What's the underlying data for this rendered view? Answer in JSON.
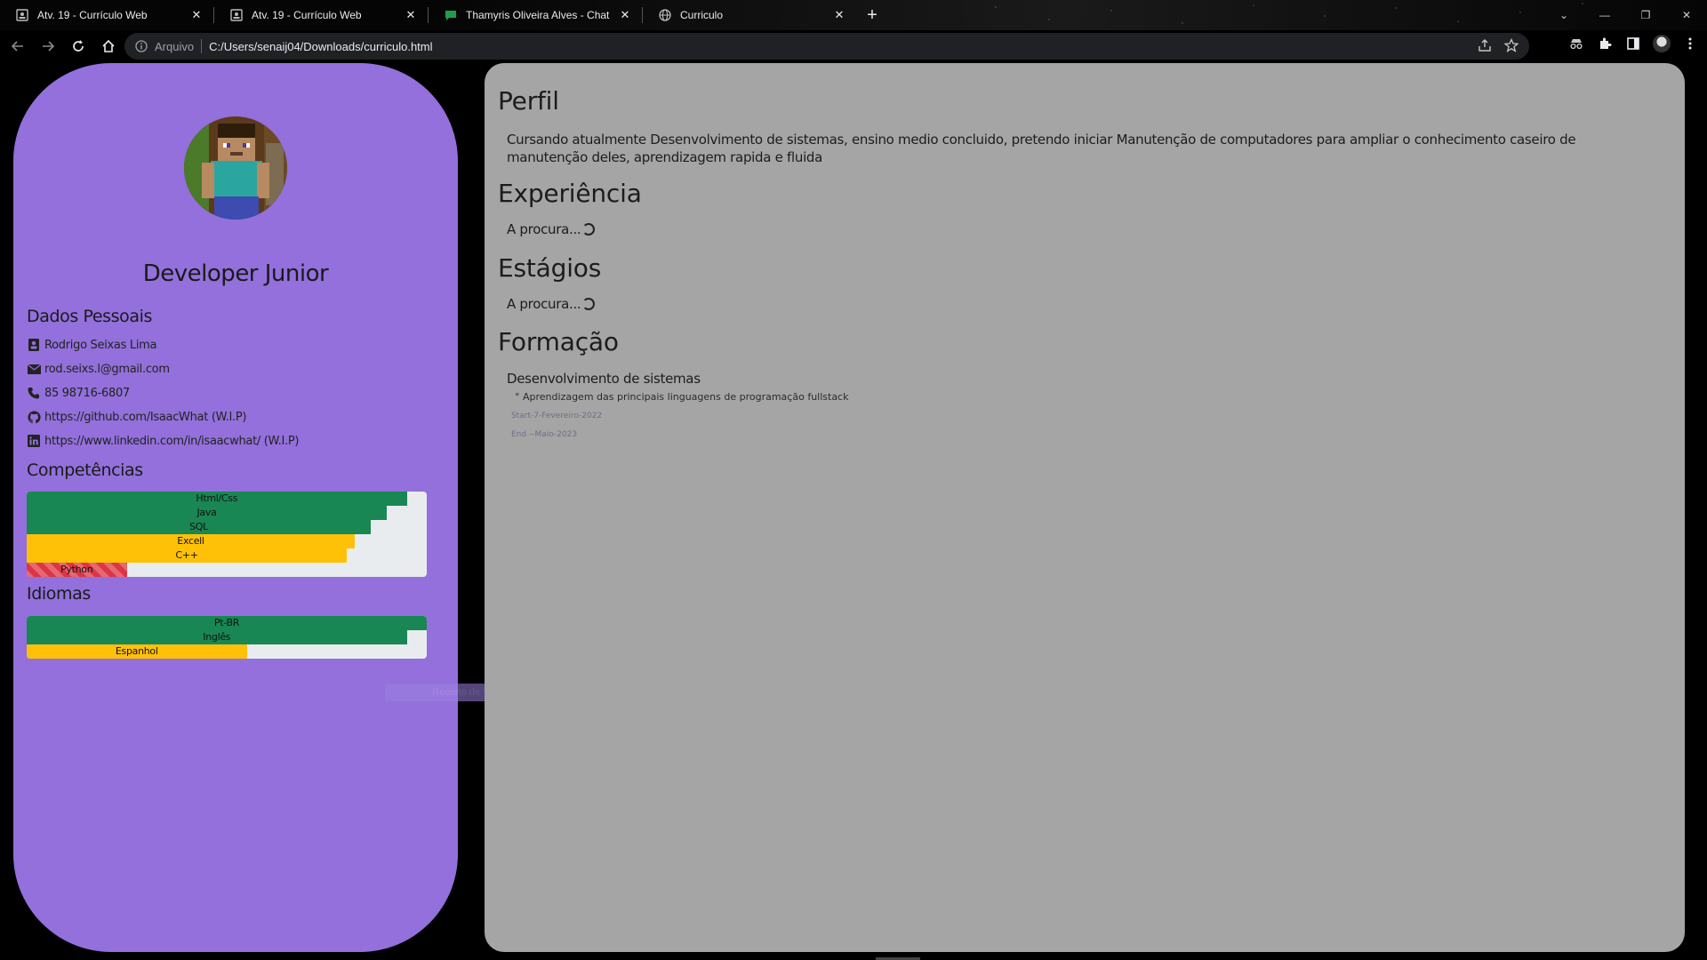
{
  "browser": {
    "tabs": [
      {
        "title": "Atv. 19 - Currículo Web",
        "icon": "page-icon"
      },
      {
        "title": "Atv. 19 - Currículo Web",
        "icon": "page-icon"
      },
      {
        "title": "Thamyris Oliveira Alves - Chat",
        "icon": "chat-icon"
      },
      {
        "title": "Curriculo",
        "icon": "globe-icon"
      }
    ],
    "address": {
      "scheme_label": "Arquivo",
      "url": "C:/Users/senaij04/Downloads/curriculo.html"
    }
  },
  "sidebar": {
    "role": "Developer Junior",
    "personal_heading": "Dados Pessoais",
    "personal": [
      {
        "icon": "contact-card-icon",
        "text": "Rodrigo Seixas Lima"
      },
      {
        "icon": "mail-icon",
        "text": "rod.seixs.l@gmail.com"
      },
      {
        "icon": "phone-icon",
        "text": "85 98716-6807"
      },
      {
        "icon": "github-icon",
        "text": "https://github.com/IsaacWhat (W.I.P)"
      },
      {
        "icon": "linkedin-icon",
        "text": "https://www.linkedin.com/in/isaacwhat/ (W.I.P)"
      }
    ],
    "skills_heading": "Competências",
    "skills": [
      {
        "label": "Html/Css",
        "level": 95,
        "color": "#198754"
      },
      {
        "label": "Java",
        "level": 90,
        "color": "#198754"
      },
      {
        "label": "SQL",
        "level": 86,
        "color": "#198754"
      },
      {
        "label": "Excell",
        "level": 82,
        "color": "#ffc107"
      },
      {
        "label": "C++",
        "level": 80,
        "color": "#ffc107"
      },
      {
        "label": "Python",
        "level": 25,
        "color": "#dc3545",
        "striped": true
      }
    ],
    "languages_heading": "Idiomas",
    "languages": [
      {
        "label": "Pt-BR",
        "level": 100,
        "color": "#198754"
      },
      {
        "label": "Inglês",
        "level": 95,
        "color": "#198754"
      },
      {
        "label": "Espanhol",
        "level": 55,
        "color": "#ffc107"
      }
    ],
    "ghost_overlay": "Recorte de Tela Cheia"
  },
  "main": {
    "profile_heading": "Perfil",
    "profile_text": "Cursando atualmente Desenvolvimento de sistemas, ensino medio concluido, pretendo iniciar Manutenção de computadores para ampliar o conhecimento caseiro de manutenção deles, aprendizagem rapida e fluida",
    "experience_heading": "Experiência",
    "experience_text": "A procura...",
    "internship_heading": "Estágios",
    "internship_text": "A procura...",
    "education_heading": "Formação",
    "education": {
      "course": "Desenvolvimento de sistemas",
      "detail": "° Aprendizagem das principais linguagens de programação fullstack",
      "start": "Start-7-Fevereiro-2022",
      "end": "End --Maio-2023"
    }
  }
}
